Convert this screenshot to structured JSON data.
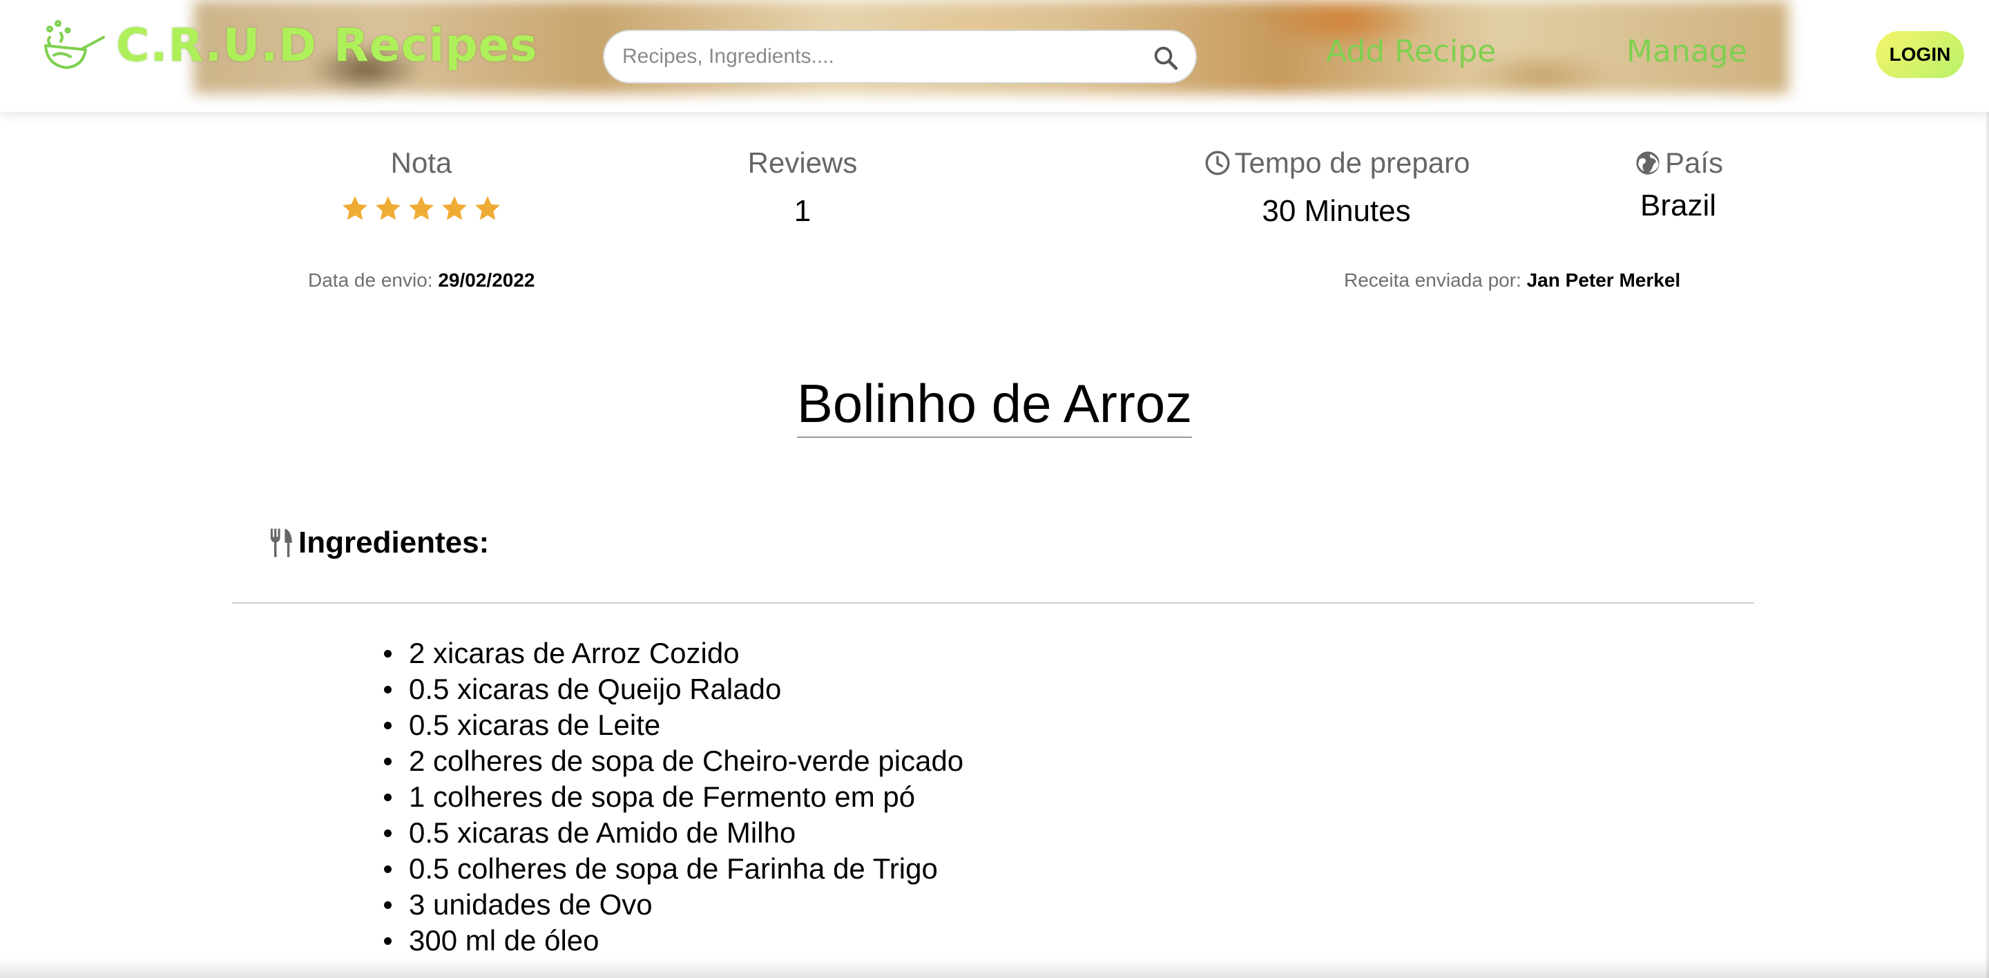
{
  "header": {
    "logo_text": "C.R.U.D Recipes",
    "search_placeholder": "Recipes, Ingredients....",
    "search_value": "",
    "nav": {
      "add_recipe": "Add Recipe",
      "manage": "Manage"
    },
    "login_label": "LOGIN"
  },
  "info": {
    "nota": {
      "label": "Nota",
      "rating": 5,
      "max": 5
    },
    "reviews": {
      "label": "Reviews",
      "value": "1"
    },
    "tempo": {
      "label": "Tempo de preparo",
      "value": "30 Minutes"
    },
    "pais": {
      "label": "País",
      "value": "Brazil"
    }
  },
  "meta": {
    "date_label": "Data de envio:",
    "date_value": "29/02/2022",
    "author_label": "Receita enviada por:",
    "author_value": "Jan Peter Merkel"
  },
  "recipe": {
    "title": "Bolinho de Arroz",
    "ingredients_heading": "Ingredientes:",
    "ingredients": [
      "2 xicaras de Arroz Cozido",
      "0.5 xicaras de Queijo Ralado",
      "0.5 xicaras de Leite",
      "2 colheres de sopa de Cheiro-verde picado",
      "1 colheres de sopa de Fermento em pó",
      "0.5 xicaras de Amido de Milho",
      "0.5 colheres de sopa de Farinha de Trigo",
      "3 unidades de Ovo",
      "300 ml de óleo"
    ]
  },
  "icons": {
    "logo": "wok-pan-icon",
    "search": "magnifier-icon",
    "star": "star-icon",
    "clock": "clock-icon",
    "globe": "globe-icon",
    "utensils": "fork-knife-icon"
  },
  "colors": {
    "brand_green": "#aef05a",
    "nav_green": "#7fd050",
    "star": "#f0ab34",
    "login_gradient_start": "#f6f46a",
    "login_gradient_end": "#b9f26a"
  }
}
